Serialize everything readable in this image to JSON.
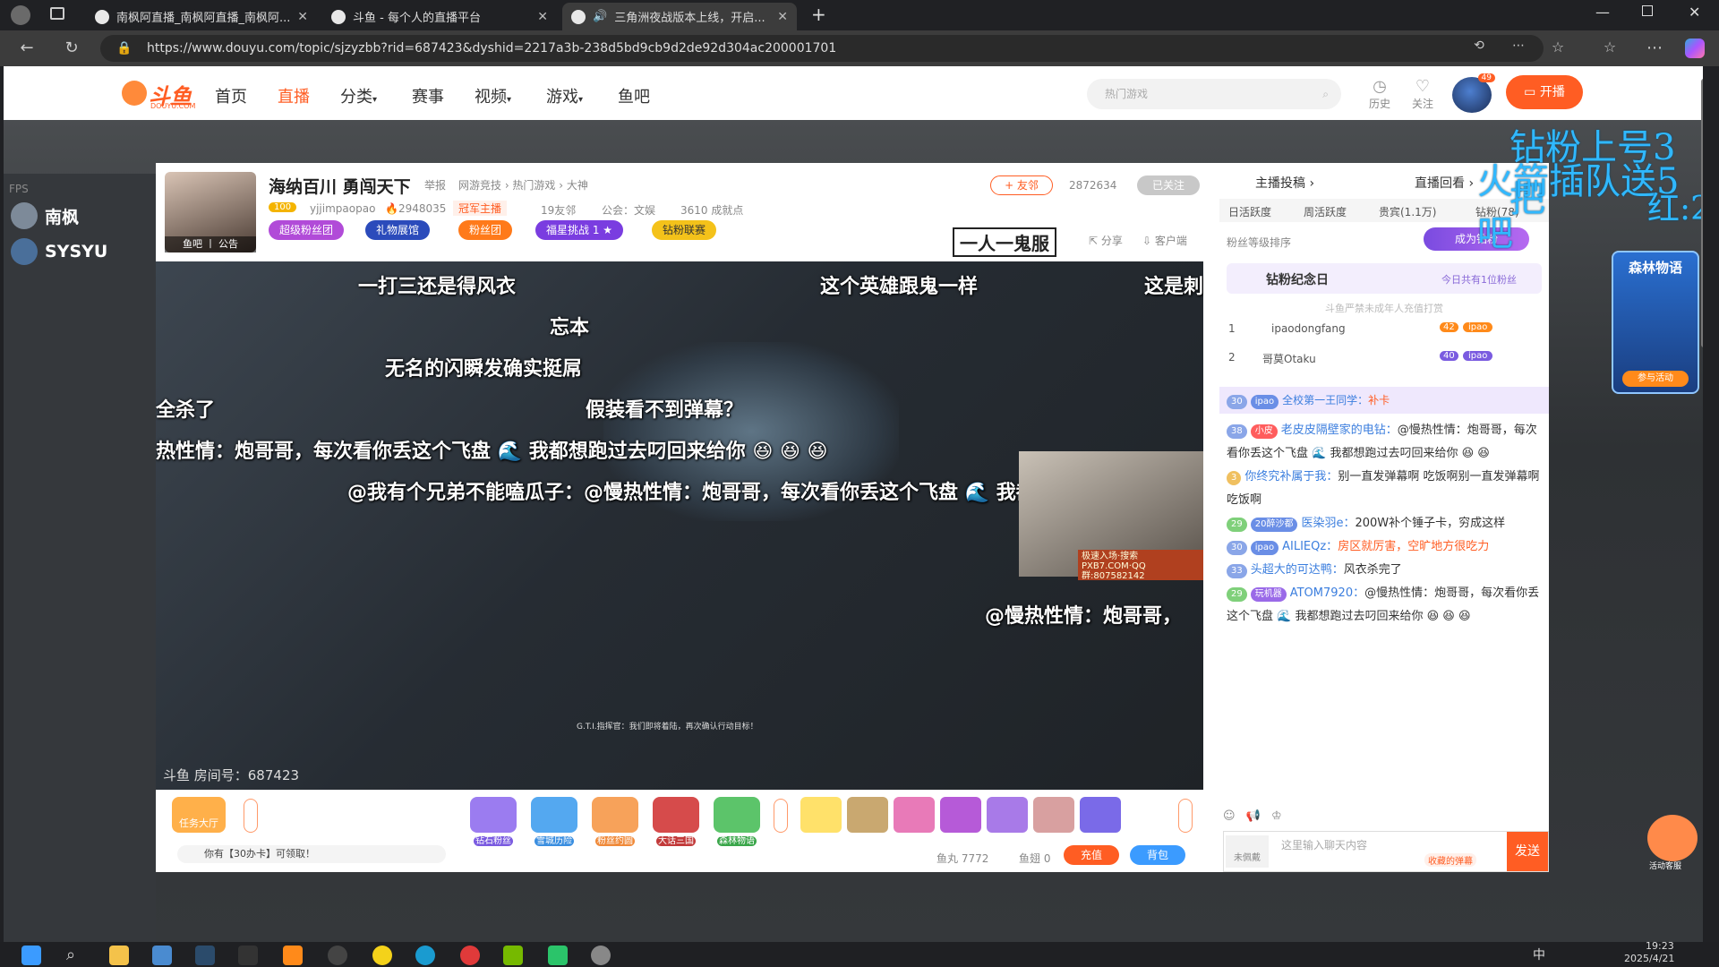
{
  "browser": {
    "tabs": [
      {
        "title": "南枫阿直播_南枫阿直播_南枫阿..."
      },
      {
        "title": "斗鱼 - 每个人的直播平台"
      },
      {
        "title": "三角洲夜战版本上线，开启..."
      }
    ],
    "url": "https://www.douyu.com/topic/sjzyzbb?rid=687423&dyshid=2217a3b-238d5bd9cb9d2de92d304ac200001701"
  },
  "nav": {
    "items": [
      "首页",
      "直播",
      "分类",
      "赛事",
      "视频",
      "游戏",
      "鱼吧"
    ],
    "search_placeholder": "热门游戏",
    "history": "历史",
    "follow": "关注",
    "avatar_badge": "49",
    "start_live": "开播"
  },
  "sidebar": {
    "fps": "FPS",
    "streamers": [
      "南枫",
      "SYSYU"
    ]
  },
  "room": {
    "title": "海纳百川 勇闯天下",
    "report": "举报",
    "category": "网游竞技 › 热门游戏 › 大神",
    "avatar_footer": "鱼吧 丨 公告",
    "badge": "100",
    "nickname": "yjjimpaopao",
    "hot": "2948035",
    "champion": "冠军主播",
    "fans_club": "19友邻",
    "guild": "公会：文娱",
    "achievement": "3610 成就点",
    "pills": [
      "超级粉丝团",
      "礼物展馆",
      "粉丝团",
      "福星挑战  1 ★",
      "钻粉联赛"
    ],
    "follow": "+ 友邻",
    "follower_count": "2872634",
    "followed": "已关注",
    "share": "分享",
    "client": "客户端",
    "slogan": "一人一鬼服",
    "room_no": "斗鱼 房间号：687423"
  },
  "danmaku": [
    {
      "text": "一打三还是得风衣"
    },
    {
      "text": "这个英雄跟鬼一样"
    },
    {
      "text": "这是刺"
    },
    {
      "text": "忘本"
    },
    {
      "text": "无名的闪瞬发确实挺屌"
    },
    {
      "text": "全杀了"
    },
    {
      "text": "假装看不到弹幕？"
    },
    {
      "text": "热性情：炮哥哥，每次看你丢这个飞盘 🌊 我都想跑过去叼回来给你 😆 😆 😆"
    },
    {
      "text": "@我有个兄弟不能嗑瓜子：@慢热性情：炮哥哥，每次看你丢这个飞盘 🌊 我都想跑"
    },
    {
      "text": "@慢热性情：炮哥哥，"
    }
  ],
  "hud": {
    "subtitle": "G.T.I.指挥官：我们即将着陆，再次确认行动目标！",
    "ad": "极速入场·搜索PXB7.COM·QQ群:807582142"
  },
  "gifts": {
    "task": "任务大厅",
    "offer": "你有【30办卡】可领取！",
    "items": [
      "钻石粉丝",
      "雪城历险",
      "粉丝约圆",
      "大话三国",
      "森林物语"
    ],
    "fishball_label": "鱼丸",
    "fishball": "7772",
    "fishfin_label": "鱼翅",
    "fishfin": "0",
    "recharge": "充值",
    "backpack": "背包"
  },
  "chat": {
    "tabs": [
      "主播投稿 ›",
      "直播回看 ›"
    ],
    "rank_tabs": [
      "日活跃度",
      "周活跃度",
      "贵宾(1.1万)",
      "钻粉(78)"
    ],
    "rank_label": "粉丝等级排序",
    "become_fan": "成为钻粉",
    "anniversary": "钻粉纪念日",
    "anniversary_note": "今日共有1位粉丝",
    "notice": "斗鱼严禁未成年人充值打赏",
    "leaders": [
      {
        "rank": "1",
        "name": "ipaodongfang",
        "level": "42",
        "tag": "ipao"
      },
      {
        "rank": "2",
        "name": "哥莫Otaku",
        "level": "40",
        "tag": "ipao"
      }
    ],
    "messages": [
      {
        "level": "30",
        "fan": "ipao",
        "user": "全校第一王同学：",
        "text": "补卡"
      },
      {
        "level": "38",
        "fan": "小皮",
        "user": "老皮皮隔壁家的电钻：",
        "text": "@慢热性情：炮哥哥，每次看你丢这个飞盘 🌊 我都想跑过去叼回来给你 😆 😆"
      },
      {
        "level": "3",
        "fan": "",
        "user": "你终究补属于我：",
        "text": "别一直发弹幕啊 吃饭啊别一直发弹幕啊 吃饭啊"
      },
      {
        "level": "29",
        "fan": "20醉沙都",
        "user": "医染羽e：",
        "text": "200W补个锤子卡，穷成这样"
      },
      {
        "level": "30",
        "fan": "ipao",
        "user": "AILIEQz：",
        "text": "房区就厉害，空旷地方很吃力"
      },
      {
        "level": "33",
        "fan": "",
        "user": "头超大的可达鸭：",
        "text": "风衣杀完了"
      },
      {
        "level": "29",
        "fan": "玩机器",
        "user": "ATOM7920：",
        "text": "@慢热性情：炮哥哥，每次看你丢这个飞盘 🌊 我都想跑过去叼回来给你 😆 😆 😆"
      }
    ],
    "input_placeholder": "这里输入聊天内容",
    "unlock": "未佩戴",
    "send": "发送",
    "collect": "收藏的弹幕"
  },
  "overlay_text": [
    "钻粉上号3把",
    "火箭插队送5吧",
    "红:2"
  ],
  "activity": {
    "title": "森林物语",
    "join": "参与活动",
    "service": "活动客服"
  },
  "taskbar": {
    "time": "19:23",
    "date": "2025/4/21",
    "lang": "中"
  }
}
